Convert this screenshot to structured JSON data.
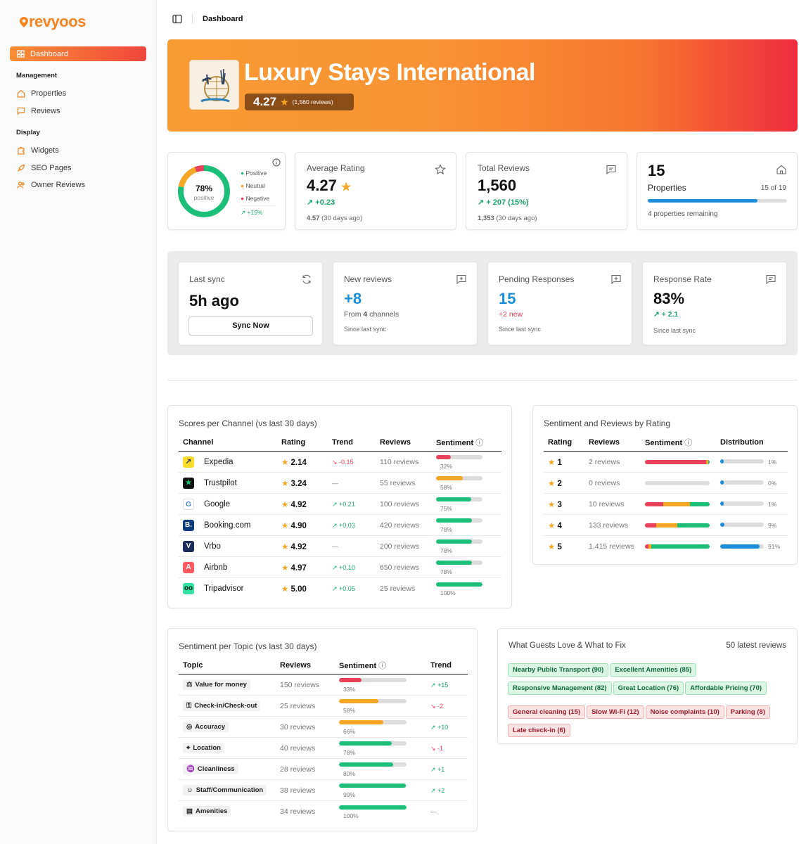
{
  "app": {
    "name": "revyoos"
  },
  "sidebar": {
    "active": "Dashboard",
    "sections": [
      {
        "title": "Management",
        "items": [
          "Properties",
          "Reviews"
        ]
      },
      {
        "title": "Display",
        "items": [
          "Widgets",
          "SEO Pages",
          "Owner Reviews"
        ]
      }
    ]
  },
  "topbar": {
    "breadcrumb": "Dashboard"
  },
  "hero": {
    "title": "Luxury Stays International",
    "rating": "4.27",
    "reviews": "(1,560 reviews)"
  },
  "stats": {
    "sentiment": {
      "pct": "78%",
      "label": "positive",
      "positive_fraction": 0.78,
      "neutral_fraction": 0.16,
      "negative_fraction": 0.06,
      "legend": [
        "Positive",
        "Neutral",
        "Negative"
      ],
      "trend": "+15%"
    },
    "average": {
      "label": "Average Rating",
      "value": "4.27",
      "delta": "+0.23",
      "prev_value": "4.57",
      "prev_label": "(30 days ago)"
    },
    "total": {
      "label": "Total Reviews",
      "value": "1,560",
      "delta": "+ 207 (15%)",
      "prev_value": "1,353",
      "prev_label": "(30 days ago)"
    },
    "properties": {
      "value": "15",
      "label": "Properties",
      "of": "15 of 19",
      "fill_fraction": 0.79,
      "remaining": "4 properties remaining"
    }
  },
  "sync": {
    "last": {
      "label": "Last sync",
      "value": "5h ago",
      "button": "Sync Now"
    },
    "new": {
      "label": "New reviews",
      "value": "+8",
      "sub_prefix": "From",
      "sub_count": "4",
      "sub_suffix": "channels",
      "foot": "Since last sync"
    },
    "pending": {
      "label": "Pending Responses",
      "value": "15",
      "sub": "+2 new",
      "foot": "Since last sync"
    },
    "rate": {
      "label": "Response Rate",
      "value": "83%",
      "sub": "+ 2.1",
      "foot": "Since last sync"
    }
  },
  "channels": {
    "title": "Scores per Channel (vs last 30 days)",
    "headers": [
      "Channel",
      "Rating",
      "Trend",
      "Reviews",
      "Sentiment"
    ],
    "rows": [
      {
        "name": "Expedia",
        "rating": "2.14",
        "trend": "-0.15",
        "dir": "down",
        "reviews": "110 reviews",
        "sent": "32%",
        "sent_frac": 0.32,
        "color": "#e8415a",
        "logo_bg": "#fddb2b",
        "logo_fg": "#1b2a6b",
        "logo_glyph": "↗"
      },
      {
        "name": "Trustpilot",
        "rating": "3.24",
        "trend": "—",
        "dir": "none",
        "reviews": "55 reviews",
        "sent": "58%",
        "sent_frac": 0.58,
        "color": "#f5a623",
        "logo_bg": "#111111",
        "logo_fg": "#1fbf6b",
        "logo_glyph": "★"
      },
      {
        "name": "Google",
        "rating": "4.92",
        "trend": "+0.21",
        "dir": "up",
        "reviews": "100 reviews",
        "sent": "75%",
        "sent_frac": 0.75,
        "color": "#1cbf7a",
        "logo_bg": "#ffffff",
        "logo_fg": "#4285f4",
        "logo_glyph": "G"
      },
      {
        "name": "Booking.com",
        "rating": "4.90",
        "trend": "+0.03",
        "dir": "up",
        "reviews": "420 reviews",
        "sent": "78%",
        "sent_frac": 0.78,
        "color": "#1cbf7a",
        "logo_bg": "#0c3b7c",
        "logo_fg": "#ffffff",
        "logo_glyph": "B."
      },
      {
        "name": "Vrbo",
        "rating": "4.92",
        "trend": "—",
        "dir": "none",
        "reviews": "200 reviews",
        "sent": "78%",
        "sent_frac": 0.78,
        "color": "#1cbf7a",
        "logo_bg": "#1d2b5a",
        "logo_fg": "#ffffff",
        "logo_glyph": "V"
      },
      {
        "name": "Airbnb",
        "rating": "4.97",
        "trend": "+0.10",
        "dir": "up",
        "reviews": "650 reviews",
        "sent": "78%",
        "sent_frac": 0.78,
        "color": "#1cbf7a",
        "logo_bg": "#ff5a5f",
        "logo_fg": "#ffffff",
        "logo_glyph": "A"
      },
      {
        "name": "Tripadvisor",
        "rating": "5.00",
        "trend": "+0.05",
        "dir": "up",
        "reviews": "25 reviews",
        "sent": "100%",
        "sent_frac": 1.0,
        "color": "#1cbf7a",
        "logo_bg": "#34e0a1",
        "logo_fg": "#111111",
        "logo_glyph": "oo"
      }
    ]
  },
  "ratings": {
    "title": "Sentiment and Reviews by Rating",
    "headers": [
      "Rating",
      "Reviews",
      "Sentiment",
      "Distribution"
    ],
    "rows": [
      {
        "rating": "1",
        "reviews": "2 reviews",
        "dist": "1%",
        "dist_frac": 0.01,
        "seg": [
          0.95,
          0.03,
          0.02
        ]
      },
      {
        "rating": "2",
        "reviews": "0 reviews",
        "dist": "0%",
        "dist_frac": 0.0,
        "seg": [
          0,
          0,
          0
        ]
      },
      {
        "rating": "3",
        "reviews": "10 reviews",
        "dist": "1%",
        "dist_frac": 0.01,
        "seg": [
          0.28,
          0.42,
          0.3
        ]
      },
      {
        "rating": "4",
        "reviews": "133 reviews",
        "dist": "9%",
        "dist_frac": 0.09,
        "seg": [
          0.17,
          0.33,
          0.5
        ]
      },
      {
        "rating": "5",
        "reviews": "1,415 reviews",
        "dist": "91%",
        "dist_frac": 0.91,
        "seg": [
          0.05,
          0.05,
          0.9
        ]
      }
    ]
  },
  "topics": {
    "title": "Sentiment per Topic (vs last 30 days)",
    "headers": [
      "Topic",
      "Reviews",
      "Sentiment",
      "Trend"
    ],
    "rows": [
      {
        "name": "Value for money",
        "icon": "money-icon",
        "reviews": "150 reviews",
        "sent": "33%",
        "sent_frac": 0.33,
        "color": "#e8415a",
        "trend": "+15",
        "dir": "up"
      },
      {
        "name": "Check-in/Check-out",
        "icon": "key-icon",
        "reviews": "25 reviews",
        "sent": "58%",
        "sent_frac": 0.58,
        "color": "#f5a623",
        "trend": "-2",
        "dir": "down"
      },
      {
        "name": "Accuracy",
        "icon": "target-icon",
        "reviews": "30 reviews",
        "sent": "66%",
        "sent_frac": 0.66,
        "color": "#f5a623",
        "trend": "+10",
        "dir": "up"
      },
      {
        "name": "Location",
        "icon": "location-icon",
        "reviews": "40 reviews",
        "sent": "78%",
        "sent_frac": 0.78,
        "color": "#1cbf7a",
        "trend": "-1",
        "dir": "down"
      },
      {
        "name": "Cleanliness",
        "icon": "broom-icon",
        "reviews": "28 reviews",
        "sent": "80%",
        "sent_frac": 0.8,
        "color": "#1cbf7a",
        "trend": "+1",
        "dir": "up"
      },
      {
        "name": "Staff/Communication",
        "icon": "staff-icon",
        "reviews": "38 reviews",
        "sent": "99%",
        "sent_frac": 0.99,
        "color": "#1cbf7a",
        "trend": "+2",
        "dir": "up"
      },
      {
        "name": "Amenities",
        "icon": "amenities-icon",
        "reviews": "34 reviews",
        "sent": "100%",
        "sent_frac": 1.0,
        "color": "#1cbf7a",
        "trend": "—",
        "dir": "none"
      }
    ]
  },
  "guests": {
    "title": "What Guests Love & What to Fix",
    "subtitle": "50 latest reviews",
    "love": [
      "Nearby Public Transport (90)",
      "Excellent Amenities (85)",
      "Responsive Management (82)",
      "Great Location (76)",
      "Affordable Pricing (70)"
    ],
    "fix": [
      "General cleaning (15)",
      "Slow Wi-Fi (12)",
      "Noise complaints (10)",
      "Parking (8)",
      "Late check-in (6)"
    ]
  },
  "colors": {
    "accent": "#f5841f",
    "positive": "#1cbf7a",
    "neutral": "#f5a623",
    "negative": "#e8415a",
    "blue": "#1a8ed8"
  }
}
